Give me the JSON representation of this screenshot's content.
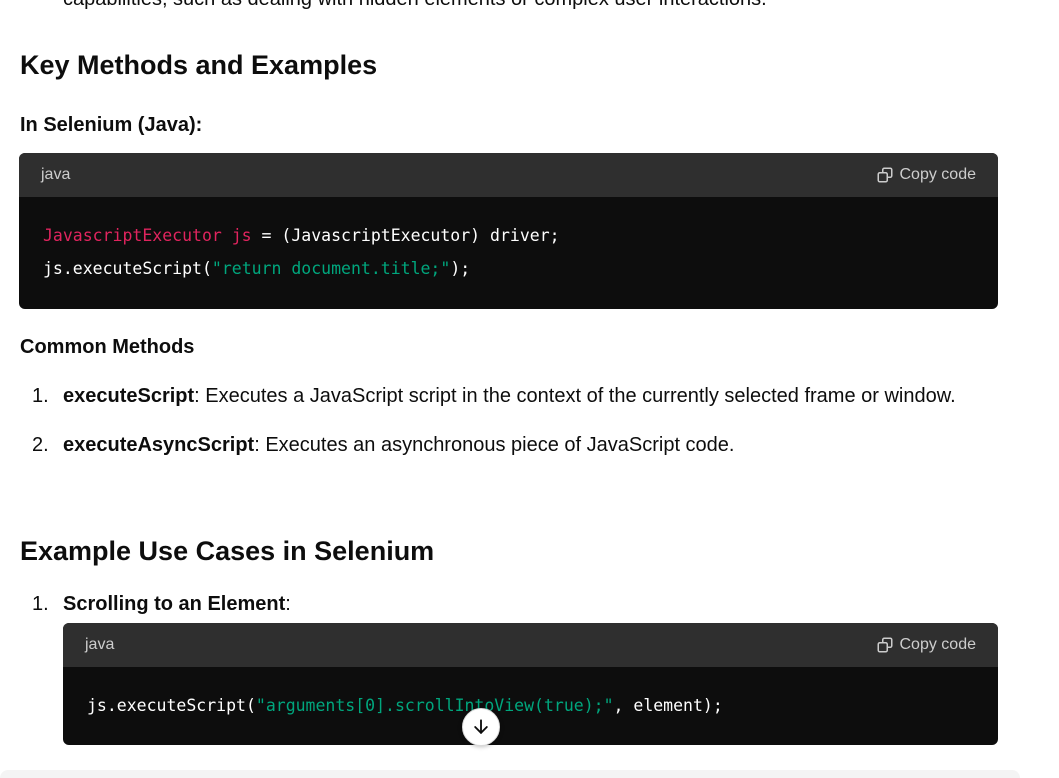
{
  "content": {
    "cut_text": "capabilities, such as dealing with hidden elements or complex user interactions.",
    "heading_key_methods": "Key Methods and Examples",
    "subheading_selenium_java": "In Selenium (Java):",
    "code1": {
      "lang": "java",
      "copy_label": "Copy code",
      "line1_type": "JavascriptExecutor",
      "line1_var": "js",
      "line1_rest": " = (JavascriptExecutor) driver;",
      "line2_start": "js.executeScript(",
      "line2_string": "\"return document.title;\"",
      "line2_end": ");"
    },
    "subheading_common_methods": "Common Methods",
    "methods": [
      {
        "num": "1.",
        "name": "executeScript",
        "desc": ": Executes a JavaScript script in the context of the currently selected frame or window."
      },
      {
        "num": "2.",
        "name": "executeAsyncScript",
        "desc": ": Executes an asynchronous piece of JavaScript code."
      }
    ],
    "heading_use_cases": "Example Use Cases in Selenium",
    "use_case": {
      "num": "1.",
      "name": "Scrolling to an Element",
      "suffix": ":"
    },
    "code2": {
      "lang": "java",
      "copy_label": "Copy code",
      "line1_start": "js.executeScript(",
      "line1_string": "\"arguments[0].scrollIntoView(true);\"",
      "line1_end": ", element);"
    }
  },
  "icons": [
    "copy-icon",
    "arrow-down-icon"
  ]
}
